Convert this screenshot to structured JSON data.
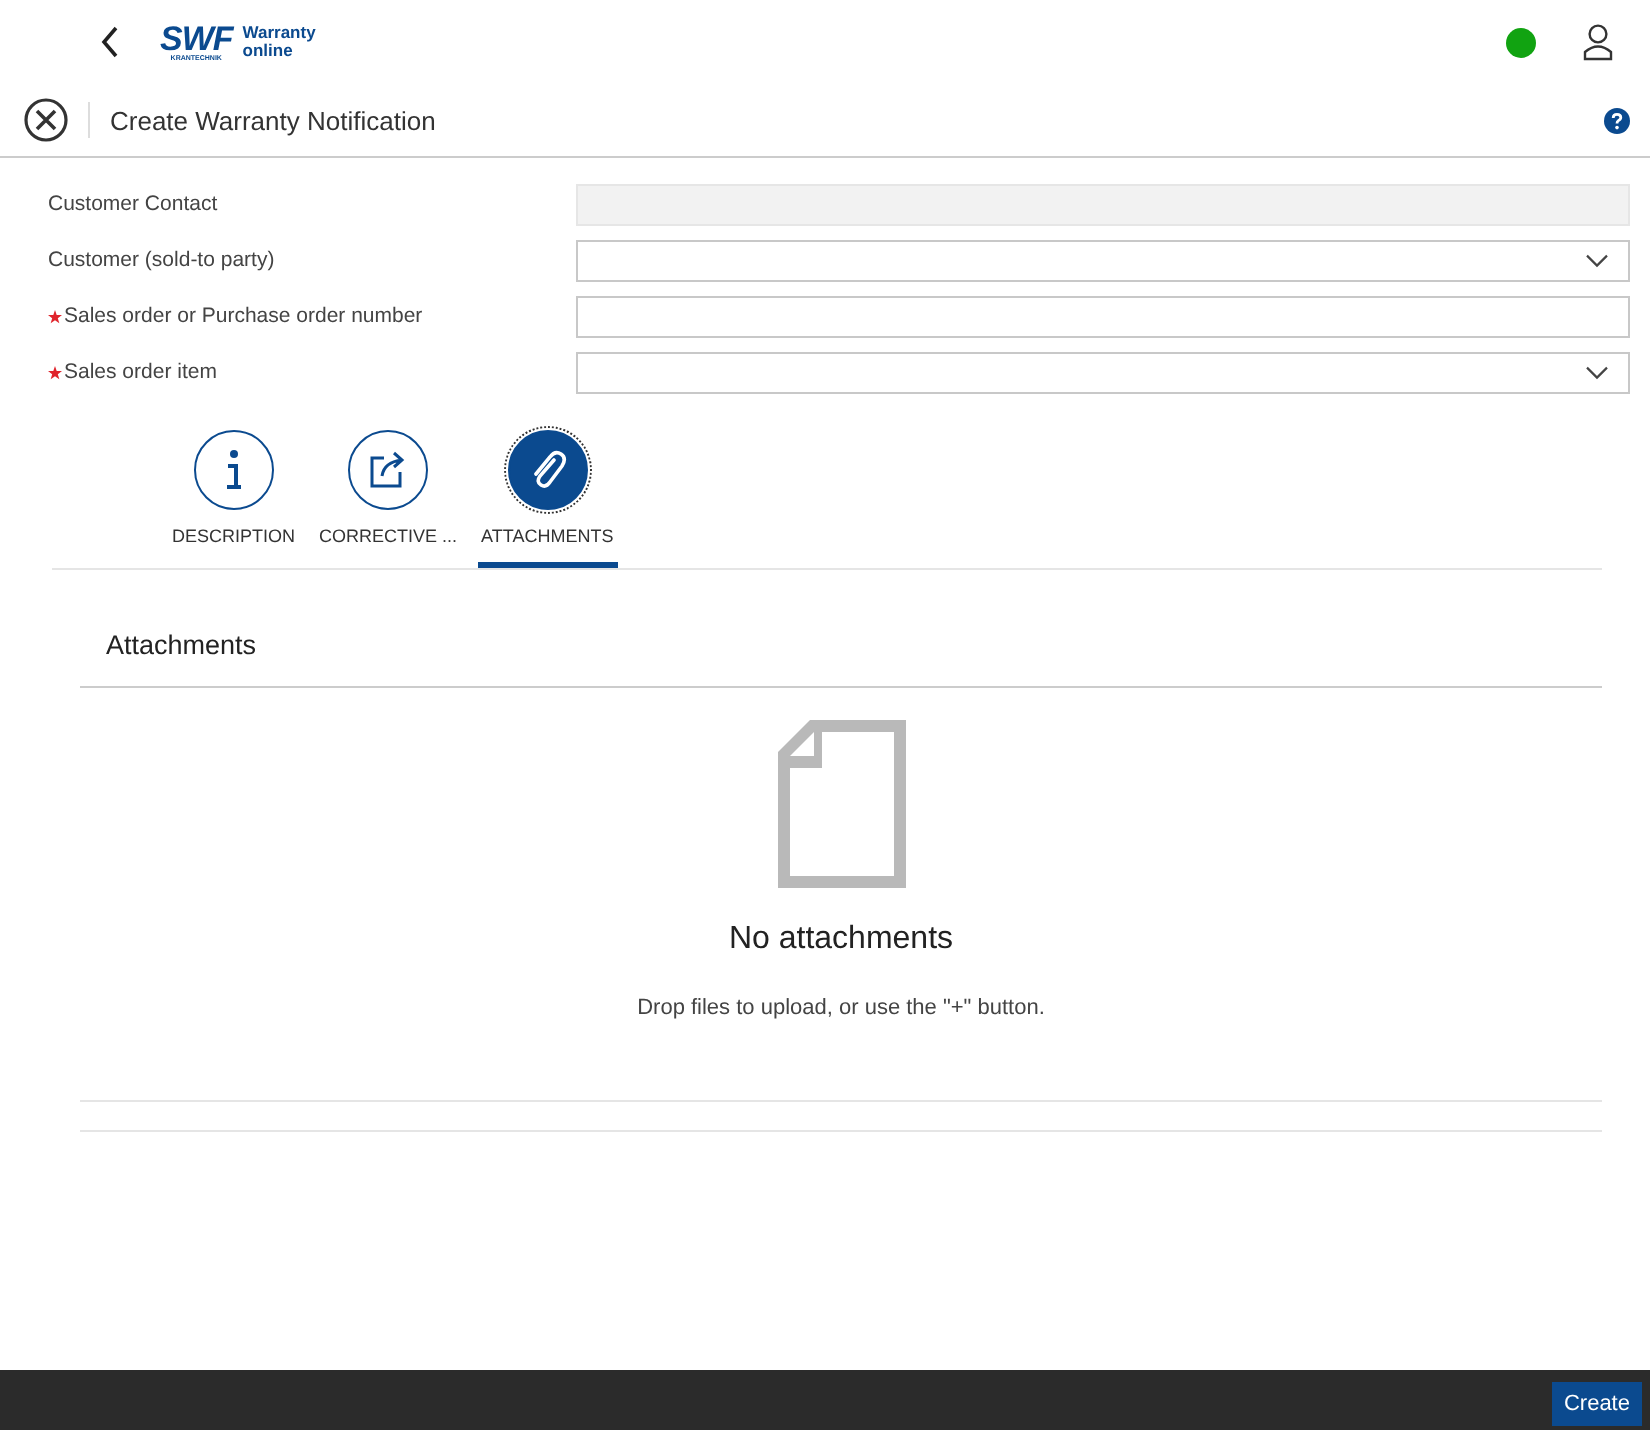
{
  "header": {
    "logo": {
      "mark": "SWF",
      "sub": "KRANTECHNIK",
      "app": "Warranty",
      "app2": "online"
    },
    "online": true
  },
  "title_bar": {
    "title": "Create Warranty Notification"
  },
  "form": [
    {
      "label": "Customer Contact",
      "required": false,
      "kind": "text",
      "disabled": true
    },
    {
      "label": "Customer (sold-to party)",
      "required": false,
      "kind": "select",
      "disabled": false
    },
    {
      "label": "Sales order or Purchase order number",
      "required": true,
      "kind": "text",
      "disabled": false
    },
    {
      "label": "Sales order item",
      "required": true,
      "kind": "select",
      "disabled": false
    }
  ],
  "tabs": [
    {
      "label": "DESCRIPTION",
      "kind": "info",
      "selected": false
    },
    {
      "label": "CORRECTIVE ...",
      "kind": "share",
      "selected": false
    },
    {
      "label": "ATTACHMENTS",
      "kind": "clip",
      "selected": true
    }
  ],
  "attachments": {
    "title": "Attachments",
    "empty_title": "No attachments",
    "empty_text": "Drop files to upload, or use the \"+\" button."
  },
  "footer": {
    "buttons": [
      "Create"
    ]
  }
}
